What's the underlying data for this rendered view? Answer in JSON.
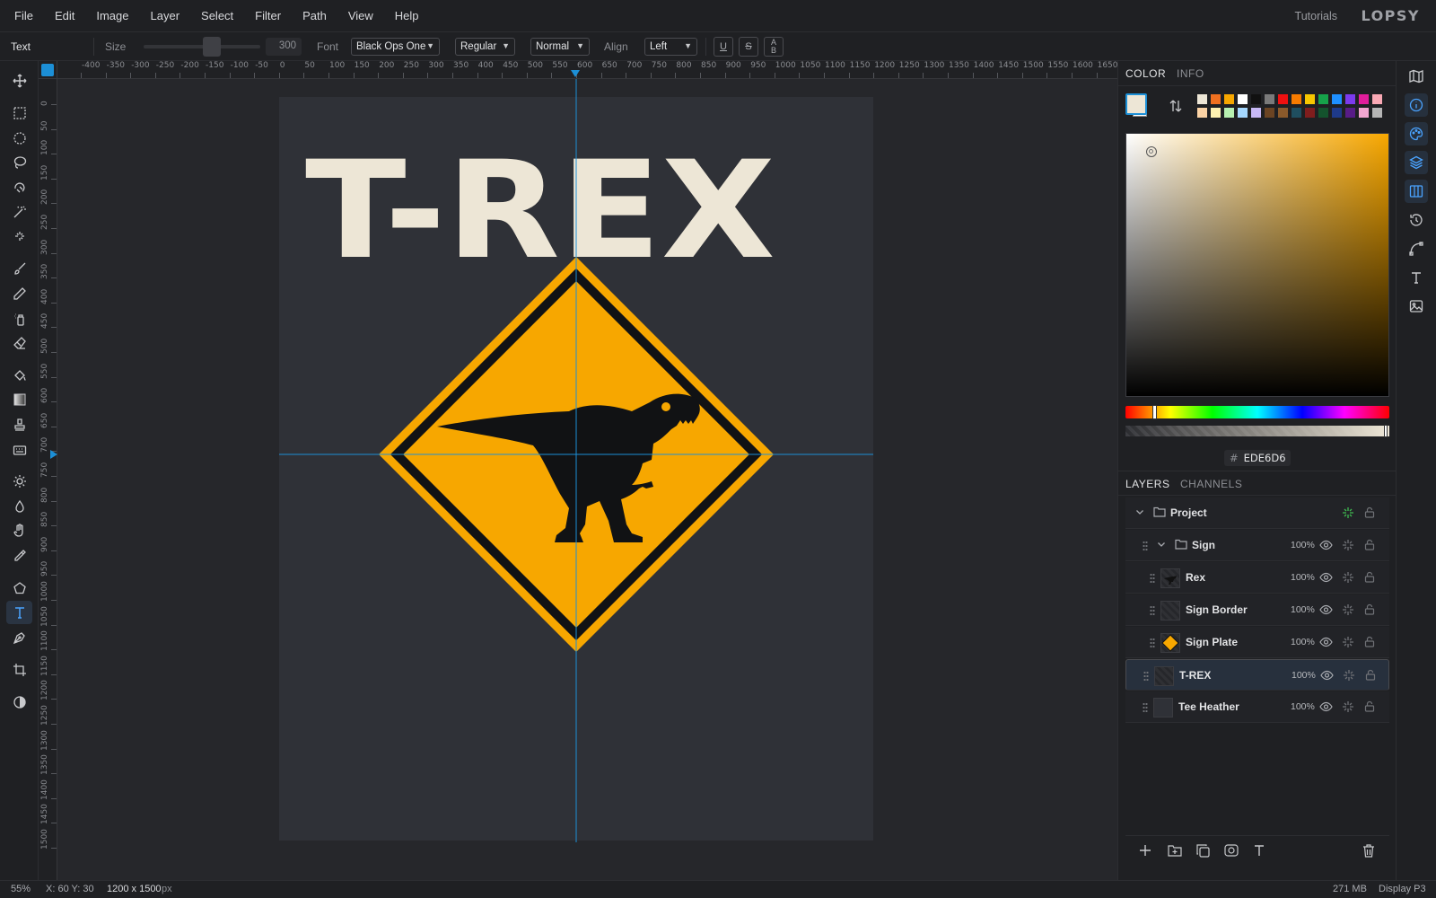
{
  "menu": {
    "items": [
      "File",
      "Edit",
      "Image",
      "Layer",
      "Select",
      "Filter",
      "Path",
      "View",
      "Help"
    ],
    "tutorials": "Tutorials",
    "brand": "LOPSY"
  },
  "options": {
    "tool_name": "Text",
    "size_label": "Size",
    "size_value": "300",
    "font_label": "Font",
    "font_value": "Black Ops One",
    "style_value": "Regular",
    "blend_value": "Normal",
    "align_label": "Align",
    "align_value": "Left",
    "underline": "U",
    "strike": "S",
    "case_top": "A",
    "case_bottom": "B"
  },
  "rulers": {
    "top": [
      "-400",
      "-350",
      "-300",
      "-250",
      "-200",
      "-150",
      "-100",
      "-50",
      "0",
      "50",
      "100",
      "150",
      "200",
      "250",
      "300",
      "350",
      "400",
      "450",
      "500",
      "550",
      "600",
      "650",
      "700",
      "750",
      "800",
      "850",
      "900",
      "950",
      "1000",
      "1050",
      "1100",
      "1150",
      "1200",
      "1250",
      "1300",
      "1350",
      "1400",
      "1450",
      "1500",
      "1550",
      "1600",
      "1650"
    ],
    "left": [
      "0",
      "50",
      "100",
      "150",
      "200",
      "250",
      "300",
      "350",
      "400",
      "450",
      "500",
      "550",
      "600",
      "650",
      "700",
      "750",
      "800",
      "850",
      "900",
      "950",
      "1000",
      "1050",
      "1100",
      "1150",
      "1200",
      "1250",
      "1300",
      "1350",
      "1400",
      "1450",
      "1500"
    ]
  },
  "canvas": {
    "headline": "T-REX",
    "headline_color": "#EDE6D6",
    "sign_color": "#F7A700",
    "border_color": "#111214",
    "artboard_color": "#2F3137",
    "guide_color": "#1C8FD6"
  },
  "color_panel": {
    "tabs": [
      "COLOR",
      "INFO"
    ],
    "hex_prefix": "#",
    "hex": "EDE6D6",
    "foreground": "#EDE6D6",
    "background": "#FFFFFF",
    "swatches": [
      "#ede6d6",
      "#f07020",
      "#f7a700",
      "#ffffff",
      "#111111",
      "#7a7a7a",
      "#ef1010",
      "#f77b00",
      "#f7c600",
      "#16a34a",
      "#1e90ff",
      "#7c3aed",
      "#e11d9b",
      "#f9a8b4",
      "#fbd3a5",
      "#fdf0b0",
      "#b7f0b0",
      "#a5d8ff",
      "#c7b8f5",
      "#6b4423",
      "#8b5a2b",
      "#1f4e5f",
      "#7f1d1d",
      "#14532d",
      "#1e3a8a",
      "#581c87",
      "#f3a6d1",
      "#b5b5b5"
    ]
  },
  "layers_panel": {
    "tabs": [
      "LAYERS",
      "CHANNELS"
    ],
    "layers": [
      {
        "name": "Project",
        "opacity": "",
        "kind": "group-root"
      },
      {
        "name": "Sign",
        "opacity": "100%",
        "kind": "group"
      },
      {
        "name": "Rex",
        "opacity": "100%",
        "kind": "layer"
      },
      {
        "name": "Sign Border",
        "opacity": "100%",
        "kind": "layer"
      },
      {
        "name": "Sign Plate",
        "opacity": "100%",
        "kind": "layer"
      },
      {
        "name": "T-REX",
        "opacity": "100%",
        "kind": "text",
        "selected": true
      },
      {
        "name": "Tee Heather",
        "opacity": "100%",
        "kind": "layer"
      }
    ],
    "footer_icons": [
      "add-layer-icon",
      "add-folder-icon",
      "duplicate-icon",
      "mask-icon",
      "text-layer-icon",
      "trash-icon"
    ]
  },
  "status": {
    "zoom": "55%",
    "coords": "X: 60 Y: 30",
    "dims": "1200 x 1500",
    "dims_unit": "px",
    "memory": "271 MB",
    "profile": "Display P3"
  }
}
